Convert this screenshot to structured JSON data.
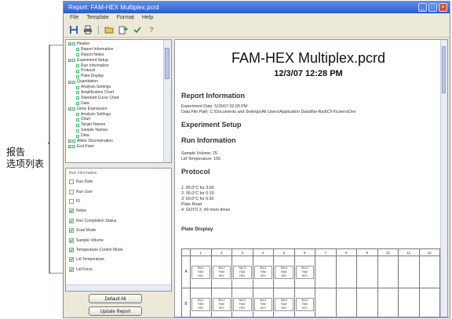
{
  "callout": {
    "line1": "报告",
    "line2": "选项列表"
  },
  "window": {
    "title": "Report: FAM-HEX Multiplex.pcrd"
  },
  "menu": [
    "File",
    "Template",
    "Format",
    "Help"
  ],
  "toolbar": {
    "icons": [
      "save-icon",
      "print-icon",
      "open-icon",
      "export-icon",
      "check-icon",
      "help-icon"
    ],
    "help_glyph": "?"
  },
  "tree": {
    "items": [
      {
        "label": "Header",
        "level": 0
      },
      {
        "label": "Report Information",
        "level": 1
      },
      {
        "label": "Report Notes",
        "level": 1
      },
      {
        "label": "Experiment Setup",
        "level": 0
      },
      {
        "label": "Run Information",
        "level": 1
      },
      {
        "label": "Protocol",
        "level": 1
      },
      {
        "label": "Plate Display",
        "level": 1
      },
      {
        "label": "Quantitation",
        "level": 0
      },
      {
        "label": "Analysis Settings",
        "level": 1
      },
      {
        "label": "Amplification Chart",
        "level": 1
      },
      {
        "label": "Standard Curve Chart",
        "level": 1
      },
      {
        "label": "Data",
        "level": 1
      },
      {
        "label": "Gene Expression",
        "level": 0
      },
      {
        "label": "Analysis Settings",
        "level": 1
      },
      {
        "label": "Chart",
        "level": 1
      },
      {
        "label": "Target Names",
        "level": 1
      },
      {
        "label": "Sample Names",
        "level": 1
      },
      {
        "label": "Data",
        "level": 1
      },
      {
        "label": "Allelic Discrimination",
        "level": 0
      },
      {
        "label": "End Point",
        "level": 0
      }
    ]
  },
  "options": {
    "header": "Run Information",
    "items": [
      {
        "label": "Run Date",
        "checked": false
      },
      {
        "label": "Run User",
        "checked": false
      },
      {
        "label": "ID",
        "checked": false
      },
      {
        "label": "Notes",
        "checked": true
      },
      {
        "label": "Run Completion Status",
        "checked": true
      },
      {
        "label": "Scan Mode",
        "checked": true
      },
      {
        "label": "Sample Volume",
        "checked": true
      },
      {
        "label": "Temperature Control Mode",
        "checked": true
      },
      {
        "label": "Lid Temperature",
        "checked": true
      },
      {
        "label": "Lid Force",
        "checked": true
      }
    ]
  },
  "buttons": {
    "default": "Default All",
    "update": "Update Report"
  },
  "report": {
    "title": "FAM-HEX Multiplex.pcrd",
    "date": "12/3/07 12:28 PM",
    "s1": "Report Information",
    "exp_date": "Experiment Date: 5/16/07 02:00 PM",
    "data_path": "Data File Path: C:\\Documents and Settings\\All Users\\Application Data\\Bio-Rad\\CFX\\Users\\Dev",
    "s2": "Experiment Setup",
    "s3": "Run Information",
    "vol": "Sample Volume: 25",
    "lid": "Lid Temperature: 105",
    "s4": "Protocol",
    "steps": [
      "1: 95.0°C for 3:00",
      "2: 95.0°C for 0:10",
      "3: 60.0°C for 0:30",
      "Plate Read",
      "4: GOTO 2, 49 more times"
    ],
    "s5": "Plate Display",
    "cols": [
      "1",
      "2",
      "3",
      "4",
      "5",
      "6",
      "7",
      "8",
      "9",
      "10",
      "11",
      "12"
    ],
    "rows": [
      {
        "label": "A",
        "wells": [
          "Std-1\nFAM\nHEX",
          "Std-2\nFAM\nHEX",
          "Std-3\nFAM\nHEX",
          "Std-4\nFAM\nHEX",
          "Std-5\nFAM\nHEX",
          "Std-6\nFAM\nHEX"
        ]
      },
      {
        "label": "B",
        "wells": [
          "Std-1\nFAM\nHEX",
          "Std-2\nFAM\nHEX",
          "Std-3\nFAM\nHEX",
          "Std-4\nFAM\nHEX",
          "Std-5\nFAM\nHEX",
          "Std-6\nFAM\nHEX"
        ]
      }
    ]
  }
}
